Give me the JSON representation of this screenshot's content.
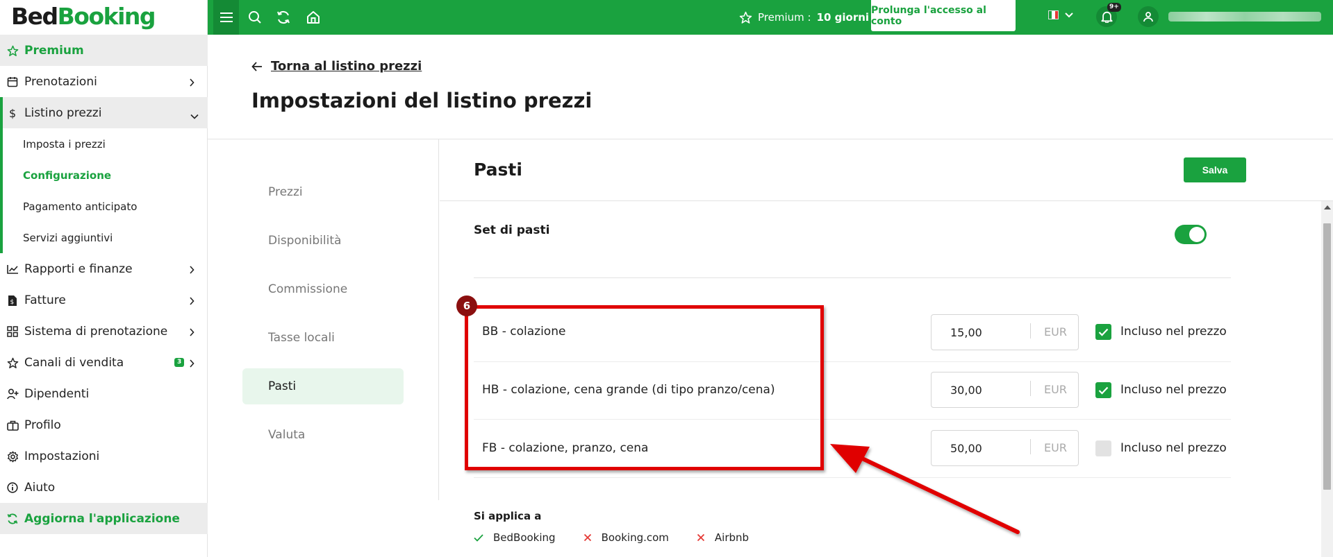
{
  "app": {
    "logo_bed": "Bed",
    "logo_booking": "Booking"
  },
  "topbar": {
    "premium_label": "Premium :",
    "premium_days": "10 giorni",
    "extend_button": "Prolunga l'accesso al conto",
    "notification_count": "9+"
  },
  "sidebar": {
    "premium": "Premium",
    "prenotazioni": "Prenotazioni",
    "listino_prezzi": "Listino prezzi",
    "sub_imposta": "Imposta i prezzi",
    "sub_configurazione": "Configurazione",
    "sub_pagamento": "Pagamento anticipato",
    "sub_servizi": "Servizi aggiuntivi",
    "rapporti": "Rapporti e finanze",
    "fatture": "Fatture",
    "sistema": "Sistema di prenotazione",
    "canali": "Canali di vendita",
    "canali_badge": "3",
    "dipendenti": "Dipendenti",
    "profilo": "Profilo",
    "impostazioni": "Impostazioni",
    "aiuto": "Aiuto",
    "aggiorna": "Aggiorna l'applicazione"
  },
  "header": {
    "back_link": "Torna al listino prezzi",
    "title": "Impostazioni del listino prezzi"
  },
  "tabs": {
    "prezzi": "Prezzi",
    "disponibilita": "Disponibilità",
    "commissione": "Commissione",
    "tasse": "Tasse locali",
    "pasti": "Pasti",
    "valuta": "Valuta"
  },
  "panel": {
    "title": "Pasti",
    "save_button": "Salva",
    "set_label": "Set di pasti",
    "set_enabled": true
  },
  "meals": {
    "bb": {
      "name": "BB - colazione",
      "price": "15,00",
      "currency": "EUR",
      "included_label": "Incluso nel prezzo",
      "included": true
    },
    "hb": {
      "name": "HB - colazione, cena grande (di tipo pranzo/cena)",
      "price": "30,00",
      "currency": "EUR",
      "included_label": "Incluso nel prezzo",
      "included": true
    },
    "fb": {
      "name": "FB - colazione, pranzo, cena",
      "price": "50,00",
      "currency": "EUR",
      "included_label": "Incluso nel prezzo",
      "included": false
    }
  },
  "annotation": {
    "step_number": "6",
    "box_color": "#e00000"
  },
  "applies": {
    "title": "Si applica a",
    "bedbooking": "BedBooking",
    "booking": "Booking.com",
    "airbnb": "Airbnb"
  },
  "colors": {
    "brand_green": "#1aa23f",
    "dark_green": "#148a35",
    "annotation_red": "#e00000"
  }
}
